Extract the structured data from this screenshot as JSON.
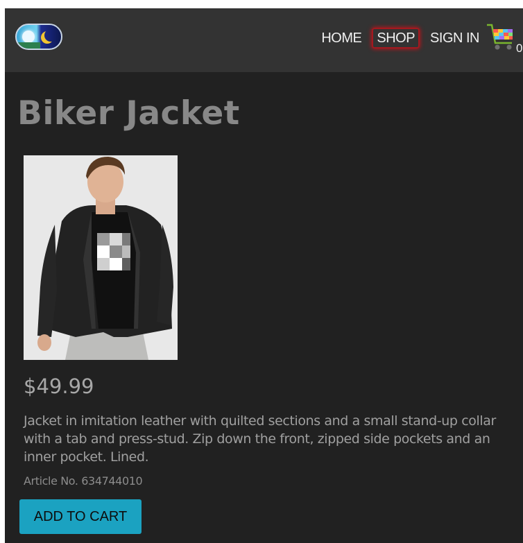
{
  "nav": {
    "logo_alt": "Sun and moon logo",
    "links": [
      {
        "label": "HOME",
        "active": false
      },
      {
        "label": "SHOP",
        "active": true
      },
      {
        "label": "SIGN IN",
        "active": false
      }
    ],
    "cart_count": "0"
  },
  "product": {
    "title": "Biker Jacket",
    "image_alt": "Man wearing black biker jacket",
    "price": "$49.99",
    "description": "Jacket in imitation leather with quilted sections and a small stand-up collar with a tab and press-stud. Zip down the front, zipped side pockets and an inner pocket. Lined.",
    "article": "Article No. 634744010",
    "add_to_cart_label": "ADD TO CART"
  },
  "colors": {
    "page_background": "#212121",
    "navbar_background": "#333333",
    "active_link_border": "#a3191f",
    "button_background": "#1ba2c1"
  }
}
